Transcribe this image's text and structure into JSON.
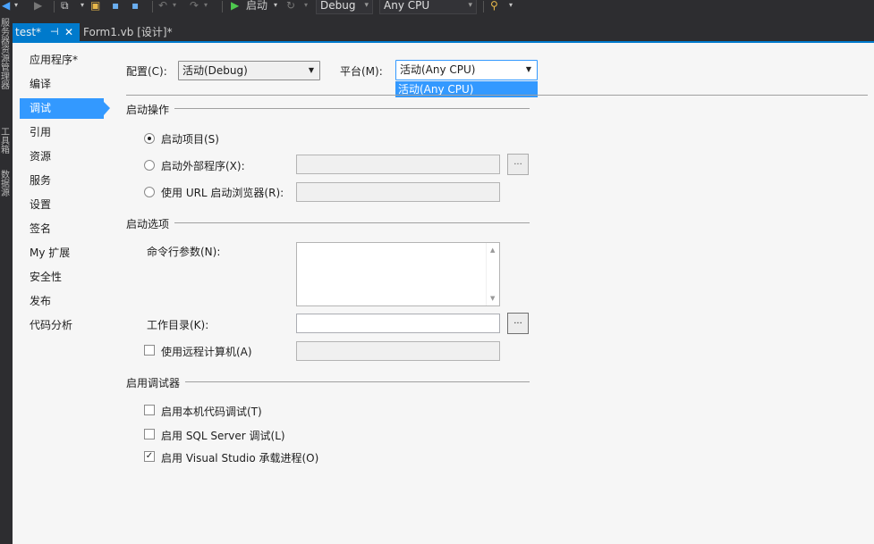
{
  "toolbar": {
    "start_label": "启动",
    "config_value": "Debug",
    "platform_value": "Any CPU",
    "icons": [
      "nav-back-icon",
      "nav-forward-icon",
      "new-project-icon",
      "open-file-icon",
      "save-icon",
      "save-all-icon",
      "undo-icon",
      "redo-icon",
      "start-icon",
      "attach-icon",
      "find-icon"
    ]
  },
  "tabs": [
    {
      "label": "test*",
      "active": true
    },
    {
      "label": "Form1.vb [设计]*",
      "active": false
    }
  ],
  "side_strip": {
    "labels": [
      "服务器资源管理器",
      "工具箱",
      "数据源"
    ]
  },
  "nav": {
    "items": [
      {
        "label": "应用程序*"
      },
      {
        "label": "编译"
      },
      {
        "label": "调试",
        "active": true
      },
      {
        "label": "引用"
      },
      {
        "label": "资源"
      },
      {
        "label": "服务"
      },
      {
        "label": "设置"
      },
      {
        "label": "签名"
      },
      {
        "label": "My 扩展"
      },
      {
        "label": "安全性"
      },
      {
        "label": "发布"
      },
      {
        "label": "代码分析"
      }
    ]
  },
  "config": {
    "label": "配置(C):",
    "value": "活动(Debug)"
  },
  "platform": {
    "label": "平台(M):",
    "value": "活动(Any CPU)",
    "dropdown_option": "活动(Any CPU)"
  },
  "start_action": {
    "title": "启动操作",
    "start_project": "启动项目(S)",
    "start_external": "启动外部程序(X):",
    "start_url": "使用 URL 启动浏览器(R):",
    "browse": "..."
  },
  "start_options": {
    "title": "启动选项",
    "cmd_args": "命令行参数(N):",
    "work_dir": "工作目录(K):",
    "remote": "使用远程计算机(A)",
    "browse": "..."
  },
  "debuggers": {
    "title": "启用调试器",
    "native": "启用本机代码调试(T)",
    "sql": "启用 SQL Server 调试(L)",
    "vshost": "启用 Visual Studio 承载进程(O)"
  },
  "colors": {
    "accent": "#007acc",
    "selection": "#3399ff",
    "chrome": "#2d2d30",
    "content": "#f6f6f6"
  }
}
